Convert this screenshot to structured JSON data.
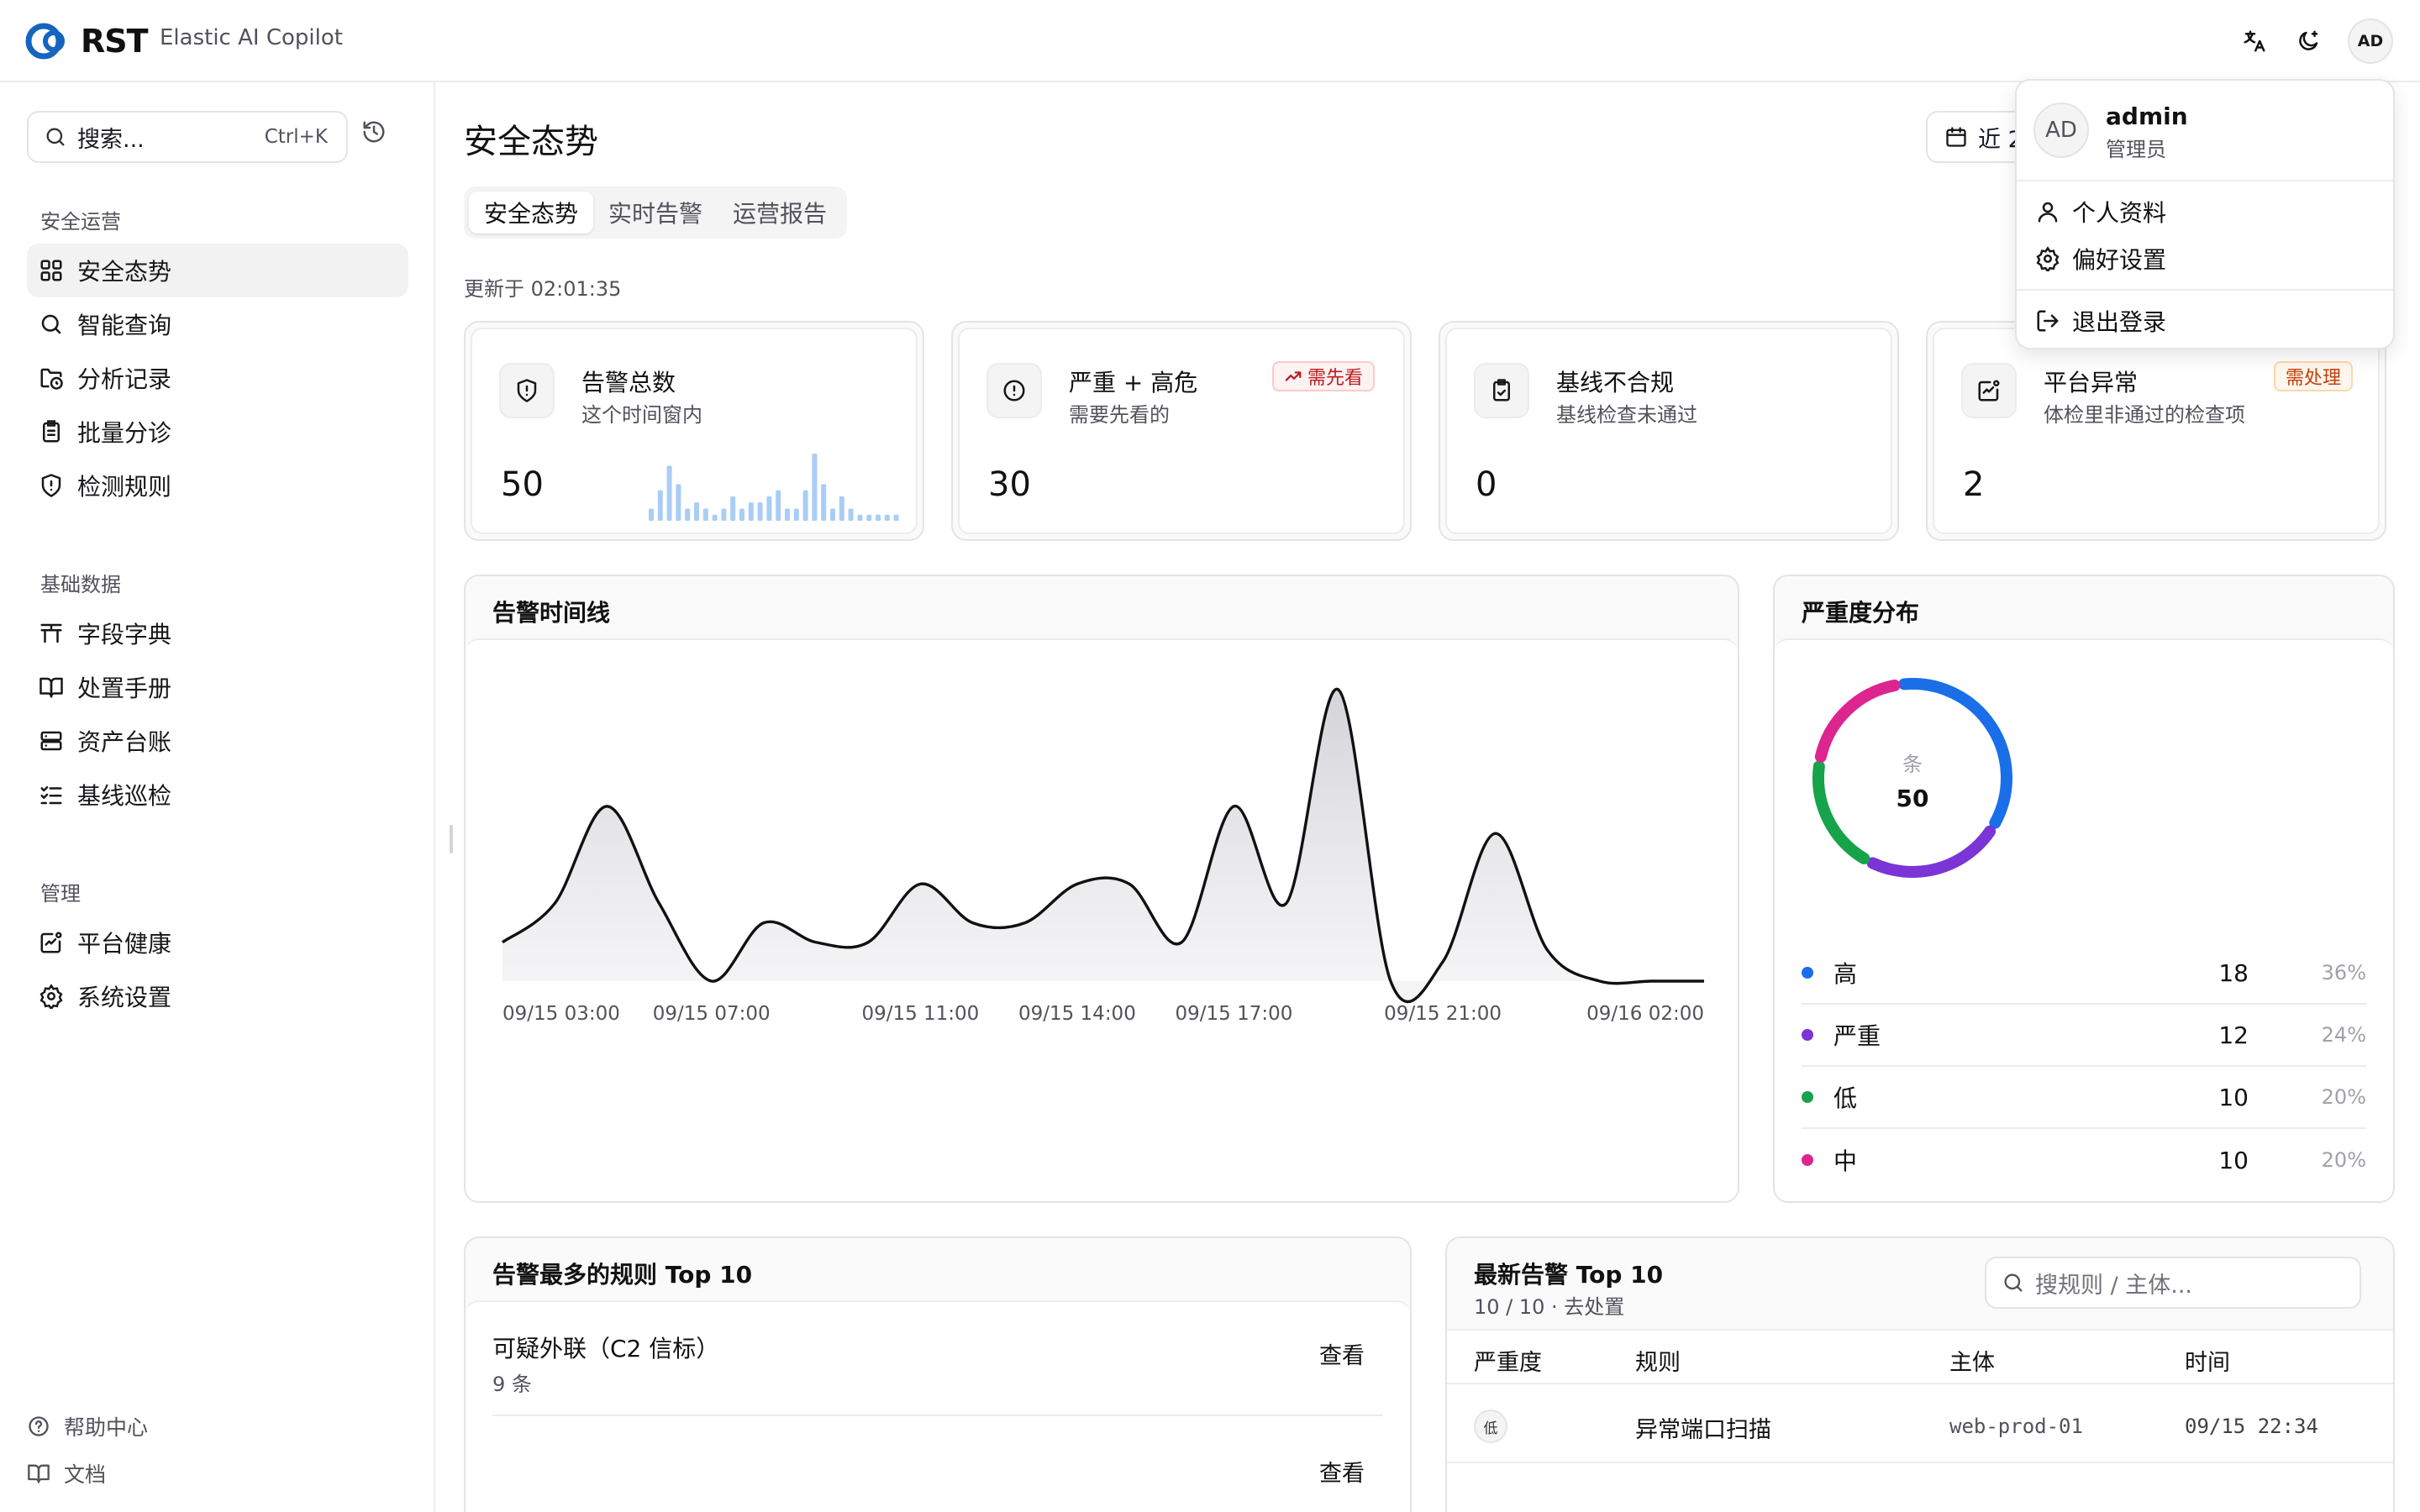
{
  "header": {
    "logo_text": "RST",
    "app_name": "Elastic AI Copilot",
    "avatar_initials": "AD"
  },
  "sidebar": {
    "search_placeholder": "搜索...",
    "search_shortcut": "Ctrl+K",
    "sections": [
      {
        "label": "安全运营",
        "items": [
          {
            "label": "安全态势",
            "icon": "grid-icon",
            "active": true
          },
          {
            "label": "智能查询",
            "icon": "search-icon"
          },
          {
            "label": "分析记录",
            "icon": "folder-clock-icon"
          },
          {
            "label": "批量分诊",
            "icon": "clipboard-list-icon"
          },
          {
            "label": "检测规则",
            "icon": "shield-alert-icon"
          }
        ]
      },
      {
        "label": "基础数据",
        "items": [
          {
            "label": "字段字典",
            "icon": "table-icon"
          },
          {
            "label": "处置手册",
            "icon": "book-open-icon"
          },
          {
            "label": "资产台账",
            "icon": "server-icon"
          },
          {
            "label": "基线巡检",
            "icon": "list-checks-icon"
          }
        ]
      },
      {
        "label": "管理",
        "items": [
          {
            "label": "平台健康",
            "icon": "activity-icon"
          },
          {
            "label": "系统设置",
            "icon": "gear-icon"
          }
        ]
      }
    ],
    "footer": [
      {
        "label": "帮助中心",
        "icon": "help-circle-icon"
      },
      {
        "label": "文档",
        "icon": "book-icon"
      }
    ]
  },
  "main": {
    "title": "安全态势",
    "tabs": [
      "安全态势",
      "实时告警",
      "运营报告"
    ],
    "updated": "更新于 02:01:35",
    "range_label": "近 2",
    "kpis": [
      {
        "title": "告警总数",
        "sub": "这个时间窗内",
        "value": "50",
        "badge": ""
      },
      {
        "title": "严重 + 高危",
        "sub": "需要先看的",
        "value": "30",
        "badge": "需先看"
      },
      {
        "title": "基线不合规",
        "sub": "基线检查未通过",
        "value": "0",
        "badge": ""
      },
      {
        "title": "平台异常",
        "sub": "体检里非通过的检查项",
        "value": "2",
        "badge": "需处理"
      }
    ],
    "sparkline": [
      2,
      5,
      9,
      6,
      2,
      3,
      2,
      1,
      2,
      4,
      2,
      3,
      3,
      4,
      5,
      2,
      2,
      5,
      11,
      6,
      2,
      4,
      2,
      1,
      1,
      1,
      1,
      1
    ],
    "timeline_title": "告警时间线",
    "severity_title": "严重度分布",
    "donut_center_label": "条",
    "donut_center_value": "50",
    "severity": [
      {
        "name": "高",
        "count": "18",
        "pct": "36%",
        "color": "#1a6fe8"
      },
      {
        "name": "严重",
        "count": "12",
        "pct": "24%",
        "color": "#7b34d6"
      },
      {
        "name": "低",
        "count": "10",
        "pct": "20%",
        "color": "#17a34a"
      },
      {
        "name": "中",
        "count": "10",
        "pct": "20%",
        "color": "#dd2590"
      }
    ],
    "top_rules_title": "告警最多的规则 Top 10",
    "top_rules": [
      {
        "name": "可疑外联（C2 信标）",
        "count": "9 条",
        "action": "查看"
      },
      {
        "name": "",
        "count": "",
        "action": "查看"
      }
    ],
    "latest_title": "最新告警 Top 10",
    "latest_sub": "10 / 10 · 去处置",
    "latest_search_placeholder": "搜规则 / 主体...",
    "latest_columns": [
      "严重度",
      "规则",
      "主体",
      "时间"
    ],
    "latest_rows": [
      {
        "severity": "低",
        "rule": "异常端口扫描",
        "host": "web-prod-01",
        "time": "09/15 22:34"
      }
    ]
  },
  "chart_data": [
    {
      "type": "area",
      "title": "告警时间线",
      "x_tick_labels": [
        "09/15 03:00",
        "09/15 07:00",
        "09/15 11:00",
        "09/15 14:00",
        "09/15 17:00",
        "09/15 21:00",
        "09/16 02:00"
      ],
      "x_hours": [
        0,
        1,
        2,
        3,
        4,
        5,
        6,
        7,
        8,
        9,
        10,
        11,
        12,
        13,
        14,
        15,
        16,
        17,
        18,
        19,
        20,
        21,
        22,
        23
      ],
      "values": [
        1,
        2,
        4.5,
        2,
        0,
        1.5,
        1,
        1,
        2.5,
        1.5,
        1.5,
        2.5,
        2.5,
        1,
        4.5,
        2,
        7.5,
        0,
        0.5,
        3.8,
        0.8,
        0,
        0,
        0
      ],
      "ylim": [
        0,
        8
      ],
      "grid": false,
      "legend": "none"
    },
    {
      "type": "pie",
      "title": "严重度分布",
      "categories": [
        "高",
        "严重",
        "低",
        "中"
      ],
      "values": [
        18,
        12,
        10,
        10
      ],
      "colors": [
        "#1a6fe8",
        "#7b34d6",
        "#17a34a",
        "#dd2590"
      ]
    }
  ],
  "dropdown": {
    "avatar_initials": "AD",
    "name": "admin",
    "role": "管理员",
    "items": [
      "个人资料",
      "偏好设置"
    ],
    "logout": "退出登录"
  }
}
